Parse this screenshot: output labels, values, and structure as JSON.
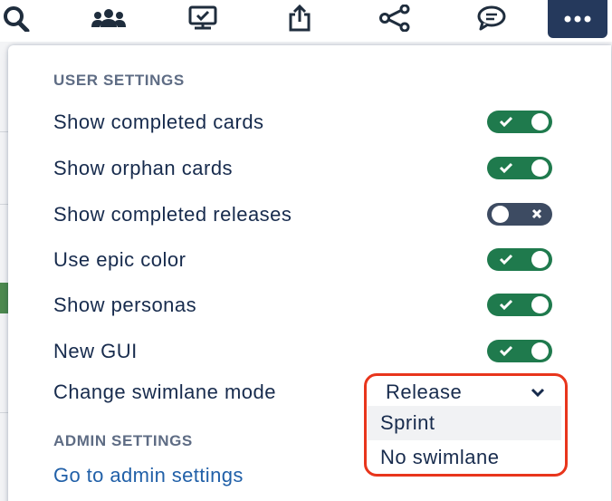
{
  "toolbar": {
    "icons": [
      "search-icon",
      "team-icon",
      "presentation-icon",
      "share-upload-icon",
      "share-network-icon",
      "comment-icon",
      "more-icon"
    ],
    "more_button_color": "#25395c"
  },
  "user_settings": {
    "heading": "USER SETTINGS",
    "items": [
      {
        "label": "Show completed cards",
        "enabled": true
      },
      {
        "label": "Show orphan cards",
        "enabled": true
      },
      {
        "label": "Show completed releases",
        "enabled": false
      },
      {
        "label": "Use epic color",
        "enabled": true
      },
      {
        "label": "Show personas",
        "enabled": true
      },
      {
        "label": "New GUI",
        "enabled": true
      }
    ],
    "swimlane": {
      "label": "Change swimlane mode",
      "selected": "Release",
      "options": [
        "Sprint",
        "No swimlane"
      ]
    }
  },
  "admin_settings": {
    "heading": "ADMIN SETTINGS",
    "link": "Go to admin settings"
  },
  "colors": {
    "toggle_on": "#1f7a4d",
    "toggle_off": "#3d4b62",
    "highlight_border": "#e8351c",
    "link": "#2160a8"
  }
}
